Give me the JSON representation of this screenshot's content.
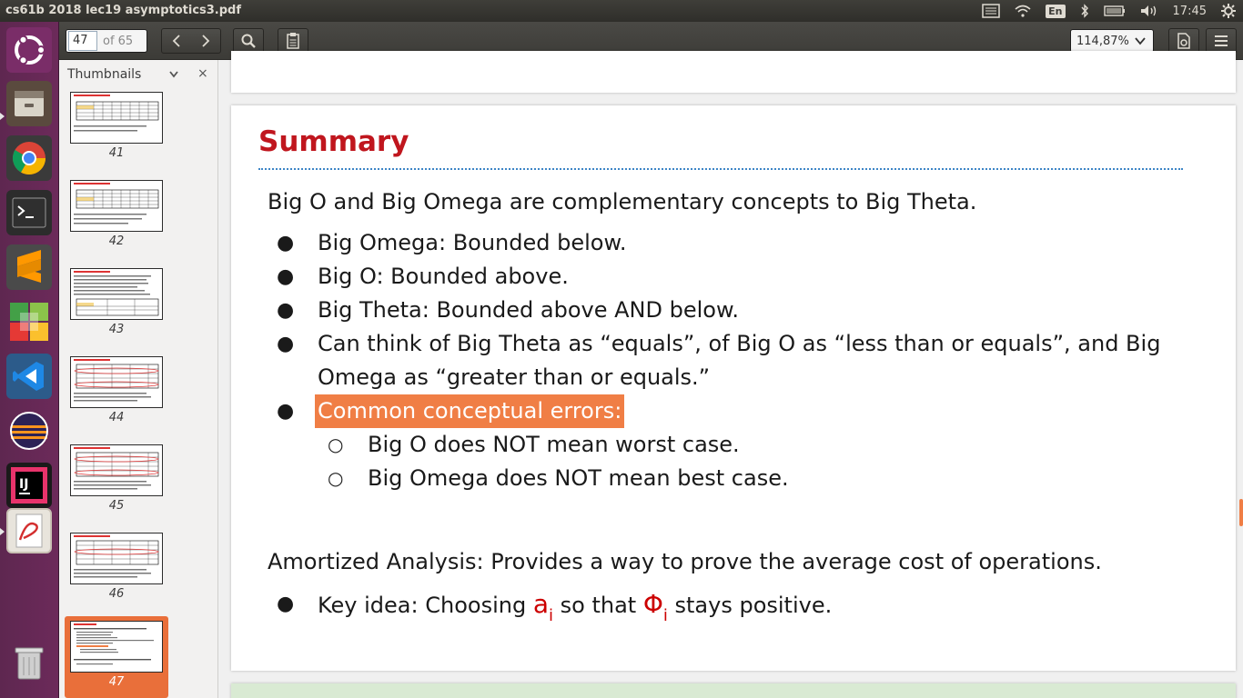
{
  "window": {
    "title": "cs61b 2018 lec19 asymptotics3.pdf"
  },
  "tray": {
    "language": "En",
    "time": "17:45"
  },
  "launcher": {
    "items": [
      "ubuntu-logo-icon",
      "files-icon",
      "chrome-icon",
      "terminal-icon",
      "sublime-text-icon",
      "libreoffice-icon",
      "vscode-icon",
      "eclipse-icon",
      "intellij-icon",
      "document-viewer-icon",
      "trash-icon"
    ]
  },
  "toolbar": {
    "page_number": "47",
    "page_total": "of 65",
    "zoom": "114,87%"
  },
  "sidebar": {
    "title": "Thumbnails",
    "close": "×",
    "thumbnails": [
      "41",
      "42",
      "43",
      "44",
      "45",
      "46",
      "47"
    ]
  },
  "slide": {
    "title": "Summary",
    "intro": "Big O and Big Omega are complementary concepts to Big Theta.",
    "bullets": [
      "Big Omega: Bounded below.",
      "Big O: Bounded above.",
      "Big Theta: Bounded above AND below."
    ],
    "bullet_long_line1": "Can think of Big Theta as “equals”, of Big O as “less than or equals”, and Big",
    "bullet_long_line2": "Omega as “greater than or equals.”",
    "errors_label": "Common conceptual errors:",
    "sub_bullets": [
      "Big O does NOT mean worst case.",
      "Big Omega does NOT mean best case."
    ],
    "amortized": "Amortized Analysis: Provides a way to prove the average cost of operations.",
    "key_idea_prefix": "Key idea: Choosing ",
    "key_idea_a": "a",
    "key_idea_sub1": "i",
    "key_idea_mid": " so that ",
    "key_idea_phi": "Φ",
    "key_idea_sub2": "i",
    "key_idea_suffix": " stays positive.",
    "bullet_char": "●",
    "sub_bullet_char": "○"
  },
  "colors": {
    "title_red": "#c0161e",
    "highlight": "#f07e45",
    "launcher_bg": "#5e2750",
    "selection": "#e96f3a"
  }
}
